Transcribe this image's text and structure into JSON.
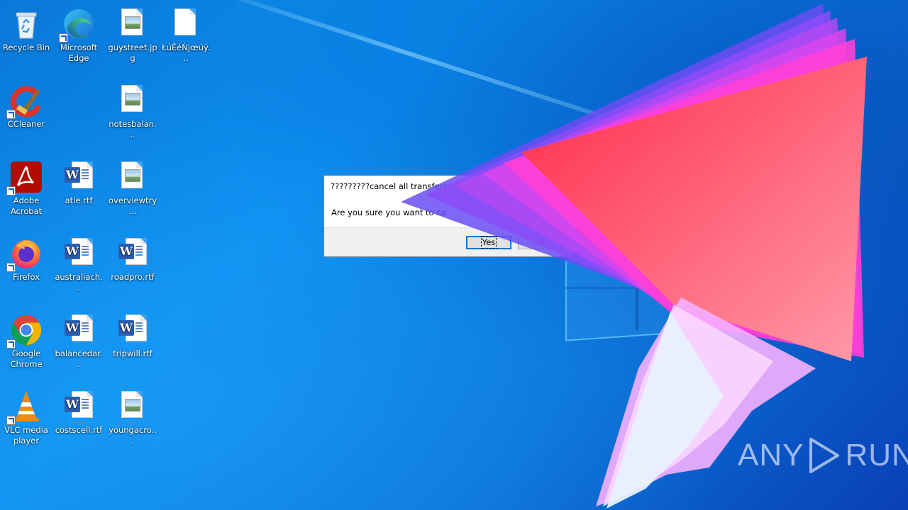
{
  "desktop": {
    "icons": [
      {
        "label": "Recycle Bin",
        "icon": "recycle-bin-icon",
        "shortcut": false
      },
      {
        "label": "Microsoft Edge",
        "icon": "edge-icon",
        "shortcut": true
      },
      {
        "label": "guystreet.jpg",
        "icon": "image-file-icon",
        "shortcut": false
      },
      {
        "label": "ŁúĚéŃjœúý...",
        "icon": "blank-file-icon",
        "shortcut": false
      },
      {
        "label": "CCleaner",
        "icon": "ccleaner-icon",
        "shortcut": true
      },
      {
        "label": "notesbalan...",
        "icon": "image-file-icon",
        "shortcut": false
      },
      {
        "label": "Adobe Acrobat",
        "icon": "adobe-acrobat-icon",
        "shortcut": true
      },
      {
        "label": "atie.rtf",
        "icon": "word-document-icon",
        "shortcut": false
      },
      {
        "label": "overviewtry...",
        "icon": "image-file-icon",
        "shortcut": false
      },
      {
        "label": "Firefox",
        "icon": "firefox-icon",
        "shortcut": true
      },
      {
        "label": "australiach...",
        "icon": "word-document-icon",
        "shortcut": false
      },
      {
        "label": "roadpro.rtf",
        "icon": "word-document-icon",
        "shortcut": false
      },
      {
        "label": "Google Chrome",
        "icon": "chrome-icon",
        "shortcut": true
      },
      {
        "label": "balancedar...",
        "icon": "word-document-icon",
        "shortcut": false
      },
      {
        "label": "tripwill.rtf",
        "icon": "word-document-icon",
        "shortcut": false
      },
      {
        "label": "VLC media player",
        "icon": "vlc-icon",
        "shortcut": true
      },
      {
        "label": "costscell.rtf",
        "icon": "word-document-icon",
        "shortcut": false
      },
      {
        "label": "youngacro...",
        "icon": "image-file-icon",
        "shortcut": false
      }
    ]
  },
  "dialog": {
    "title": "?????????cancel all transfers in w",
    "message": "Are you sure you want to ca",
    "yes_label": "Yes",
    "no_label": "N"
  },
  "watermark": {
    "left_text": "ANY",
    "right_text": "RUN"
  },
  "colors": {
    "desktop_blue": "#0b8ef0",
    "dialog_accent": "#0078d7"
  }
}
